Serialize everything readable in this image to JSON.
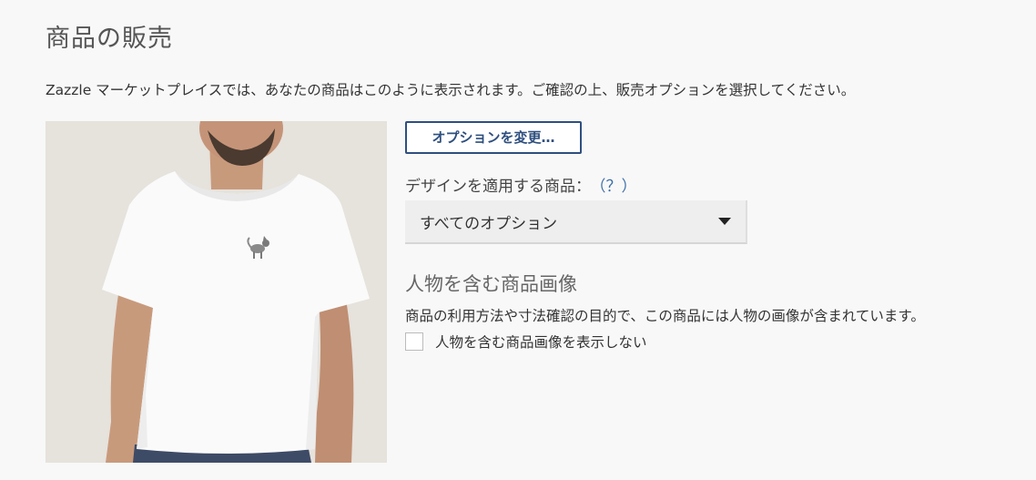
{
  "page": {
    "title": "商品の販売",
    "intro": "Zazzle マーケットプレイスでは、あなたの商品はこのように表示されます。ご確認の上、販売オプションを選択してください。"
  },
  "options": {
    "change_button_label": "オプションを変更…",
    "apply_label": "デザインを適用する商品：",
    "help_label": "（？）",
    "select_value": "すべてのオプション"
  },
  "model_images": {
    "heading": "人物を含む商品画像",
    "description": "商品の利用方法や寸法確認の目的で、この商品には人物の画像が含まれています。",
    "checkbox_label": "人物を含む商品画像を表示しない",
    "checkbox_checked": false
  },
  "product": {
    "image_subject": "man-wearing-white-tshirt",
    "print_icon": "cat-icon"
  },
  "colors": {
    "accent": "#2e4f7f",
    "link": "#3d6fa8",
    "background": "#f8f8f8",
    "image_background": "#e6e2dc",
    "shirt": "#fafafa"
  }
}
